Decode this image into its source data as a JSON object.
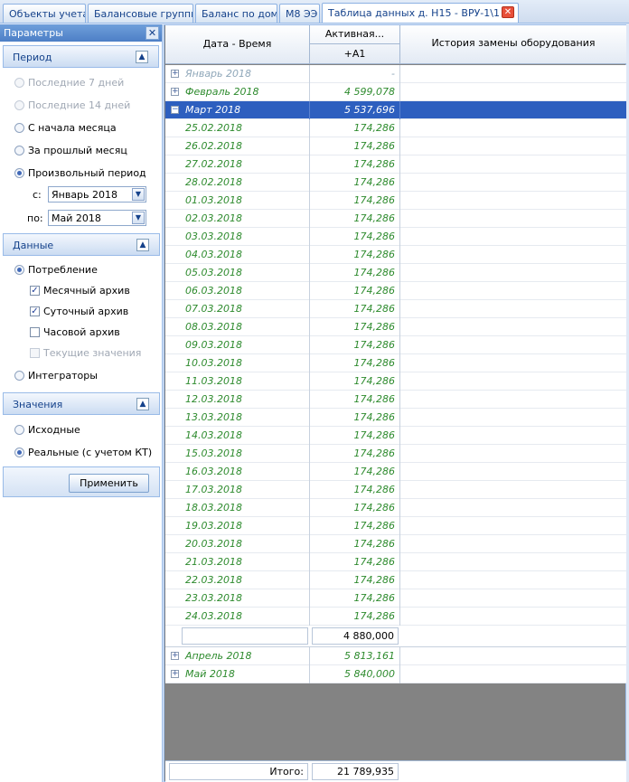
{
  "tabs": [
    {
      "label": "Объекты учета"
    },
    {
      "label": "Балансовые группы"
    },
    {
      "label": "Баланс по дому"
    },
    {
      "label": "М8 ЭЭ"
    },
    {
      "label": "Таблица данных д. Н15 - ВРУ-1\\1"
    }
  ],
  "panel": {
    "title": "Параметры",
    "period": {
      "header": "Период",
      "options": [
        "Последние 7 дней",
        "Последние 14 дней",
        "С начала месяца",
        "За прошлый месяц",
        "Произвольный период"
      ],
      "from_label": "с:",
      "from_value": "Январь 2018",
      "to_label": "по:",
      "to_value": "Май 2018"
    },
    "data": {
      "header": "Данные",
      "consumption": "Потребление",
      "monthly": "Месячный архив",
      "daily": "Суточный архив",
      "hourly": "Часовой архив",
      "current": "Текущие значения",
      "integrators": "Интеграторы"
    },
    "values": {
      "header": "Значения",
      "raw": "Исходные",
      "real": "Реальные (с учетом КТ)"
    },
    "apply": "Применить"
  },
  "grid": {
    "col_datetime": "Дата - Время",
    "col_active": "Активная...",
    "col_active_sub": "+A1",
    "col_history": "История замены оборудования",
    "groups_before": [
      {
        "label": "Январь 2018",
        "value": "-"
      },
      {
        "label": "Февраль 2018",
        "value": "4 599,078"
      }
    ],
    "expanded": {
      "label": "Март 2018",
      "value": "5 537,696"
    },
    "days": [
      {
        "date": "25.02.2018",
        "value": "174,286"
      },
      {
        "date": "26.02.2018",
        "value": "174,286"
      },
      {
        "date": "27.02.2018",
        "value": "174,286"
      },
      {
        "date": "28.02.2018",
        "value": "174,286"
      },
      {
        "date": "01.03.2018",
        "value": "174,286"
      },
      {
        "date": "02.03.2018",
        "value": "174,286"
      },
      {
        "date": "03.03.2018",
        "value": "174,286"
      },
      {
        "date": "04.03.2018",
        "value": "174,286"
      },
      {
        "date": "05.03.2018",
        "value": "174,286"
      },
      {
        "date": "06.03.2018",
        "value": "174,286"
      },
      {
        "date": "07.03.2018",
        "value": "174,286"
      },
      {
        "date": "08.03.2018",
        "value": "174,286"
      },
      {
        "date": "09.03.2018",
        "value": "174,286"
      },
      {
        "date": "10.03.2018",
        "value": "174,286"
      },
      {
        "date": "11.03.2018",
        "value": "174,286"
      },
      {
        "date": "12.03.2018",
        "value": "174,286"
      },
      {
        "date": "13.03.2018",
        "value": "174,286"
      },
      {
        "date": "14.03.2018",
        "value": "174,286"
      },
      {
        "date": "15.03.2018",
        "value": "174,286"
      },
      {
        "date": "16.03.2018",
        "value": "174,286"
      },
      {
        "date": "17.03.2018",
        "value": "174,286"
      },
      {
        "date": "18.03.2018",
        "value": "174,286"
      },
      {
        "date": "19.03.2018",
        "value": "174,286"
      },
      {
        "date": "20.03.2018",
        "value": "174,286"
      },
      {
        "date": "21.03.2018",
        "value": "174,286"
      },
      {
        "date": "22.03.2018",
        "value": "174,286"
      },
      {
        "date": "23.03.2018",
        "value": "174,286"
      },
      {
        "date": "24.03.2018",
        "value": "174,286"
      }
    ],
    "subtotal": "4 880,000",
    "groups_after": [
      {
        "label": "Апрель 2018",
        "value": "5 813,161"
      },
      {
        "label": "Май 2018",
        "value": "5 840,000"
      }
    ],
    "total_label": "Итого:",
    "total_value": "21 789,935"
  }
}
